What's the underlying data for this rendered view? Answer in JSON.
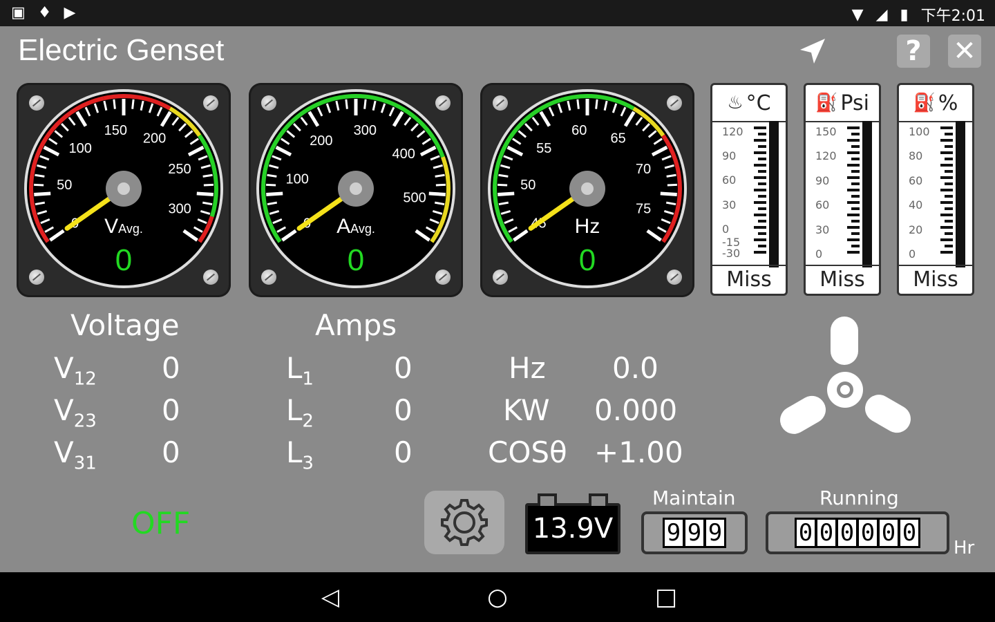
{
  "status": {
    "time": "下午2:01"
  },
  "title": "Electric Genset",
  "gauges": [
    {
      "id": "voltage",
      "unit_main": "V",
      "unit_sub": "Avg.",
      "value": "0",
      "ticks": [
        "0",
        "50",
        "100",
        "150",
        "200",
        "250",
        "300"
      ],
      "min": 0,
      "max": 320
    },
    {
      "id": "amps",
      "unit_main": "A",
      "unit_sub": "Avg.",
      "value": "0",
      "ticks": [
        "0",
        "100",
        "200",
        "300",
        "400",
        "500"
      ],
      "min": 0,
      "max": 560
    },
    {
      "id": "hz",
      "unit_main": "Hz",
      "unit_sub": "",
      "value": "0",
      "ticks": [
        "45",
        "50",
        "55",
        "60",
        "65",
        "70",
        "75"
      ],
      "min": 45,
      "max": 77
    }
  ],
  "bars": [
    {
      "id": "temp",
      "unit": "°C",
      "icon": "coolant-temp-icon",
      "scale": [
        "120",
        "90",
        "60",
        "30",
        "0",
        "-15",
        "-30"
      ],
      "status": "Miss",
      "fill": 0
    },
    {
      "id": "oil",
      "unit": "Psi",
      "icon": "oil-can-icon",
      "scale": [
        "150",
        "120",
        "90",
        "60",
        "30",
        "0"
      ],
      "status": "Miss",
      "fill": 0
    },
    {
      "id": "fuel",
      "unit": "%",
      "icon": "fuel-pump-icon",
      "scale": [
        "100",
        "80",
        "60",
        "40",
        "20",
        "0"
      ],
      "status": "Miss",
      "fill": 0
    }
  ],
  "voltage": {
    "title": "Voltage",
    "rows": [
      {
        "label": "V",
        "sub": "12",
        "value": "0"
      },
      {
        "label": "V",
        "sub": "23",
        "value": "0"
      },
      {
        "label": "V",
        "sub": "31",
        "value": "0"
      }
    ]
  },
  "amps": {
    "title": "Amps",
    "rows": [
      {
        "label": "L",
        "sub": "1",
        "value": "0"
      },
      {
        "label": "L",
        "sub": "2",
        "value": "0"
      },
      {
        "label": "L",
        "sub": "3",
        "value": "0"
      }
    ]
  },
  "power": {
    "rows": [
      {
        "label": "Hz",
        "value": "0.0"
      },
      {
        "label": "KW",
        "value": "0.000"
      },
      {
        "label": "COSθ",
        "value": "+1.00"
      }
    ]
  },
  "engine_state": "OFF",
  "battery": "13.9V",
  "maintain": {
    "label": "Maintain",
    "digits": [
      "9",
      "9",
      "9"
    ]
  },
  "running": {
    "label": "Running",
    "digits": [
      "0",
      "0",
      "0",
      "0",
      "0",
      "0"
    ],
    "unit": "Hr"
  }
}
